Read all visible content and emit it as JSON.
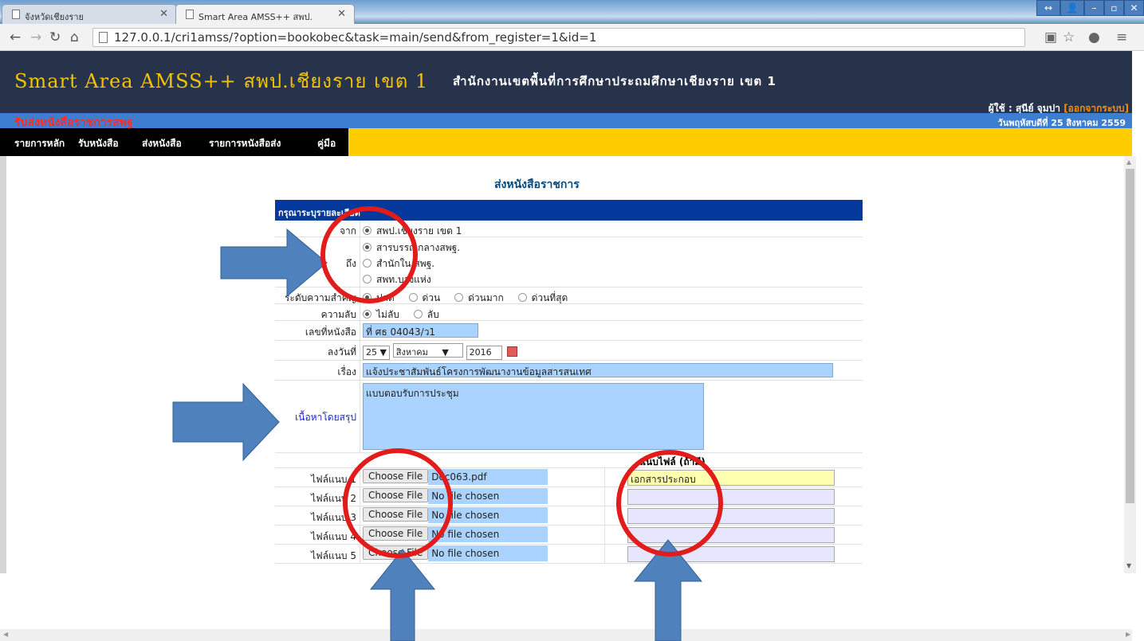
{
  "browser": {
    "tabs": [
      {
        "title": "จังหวัดเชียงราย",
        "active": false
      },
      {
        "title": "Smart Area AMSS++ สพป.",
        "active": true
      }
    ],
    "url": "127.0.0.1/cri1amss/?option=bookobec&task=main/send&from_register=1&id=1"
  },
  "header": {
    "title": "Smart Area AMSS++ สพป.เชียงราย เขต 1",
    "subtitle": "สำนักงานเขตพื้นที่การศึกษาประถมศึกษาเชียงราย เขต 1",
    "user_label": "ผู้ใช้ : สุนีย์ จุมปา",
    "logout": "[ออกจากระบบ]",
    "system_name": "รับส่งหนังสือราชการสพฐ",
    "date": "วันพฤหัสบดีที่ 25 สิงหาคม 2559"
  },
  "menu": [
    "รายการหลัก",
    "รับหนังสือ",
    "ส่งหนังสือ",
    "รายการหนังสือส่ง",
    "คู่มือ"
  ],
  "page": {
    "heading": "ส่งหนังสือราชการ",
    "form_head": "กรุณาระบุรายละเอียด",
    "labels": {
      "from": "จาก",
      "to": "ถึง",
      "priority": "ระดับความสำคัญ",
      "secret": "ความลับ",
      "doc_no": "เลขที่หนังสือ",
      "date": "ลงวันที่",
      "subject": "เรื่อง",
      "summary": "เนื้อหาโดยสรุป",
      "attachments": "แนบไฟล์ (ถ้ามี)"
    },
    "from_value": "สพป.เชียงราย เขต 1",
    "to_options": [
      "สารบรรณกลางสพฐ.",
      "สำนักใน สพฐ.",
      "สพท.บางแห่ง"
    ],
    "priority_options": [
      "ปกติ",
      "ด่วน",
      "ด่วนมาก",
      "ด่วนที่สุด"
    ],
    "secret_options": [
      "ไม่ลับ",
      "ลับ"
    ],
    "doc_no": "ที่ ศธ 04043/ว1",
    "date_day": "25",
    "date_month": "สิงหาคม",
    "date_year": "2016",
    "subject": "แจ้งประชาสัมพันธ์โครงการพัฒนางานข้อมูลสารสนเทศ",
    "summary": "แบบตอบรับการประชุม",
    "choose_file": "Choose File",
    "attachments": [
      {
        "label": "ไฟล์แนบ 1",
        "file": "Doc063.pdf",
        "desc": "เอกสารประกอบ"
      },
      {
        "label": "ไฟล์แนบ 2",
        "file": "No file chosen",
        "desc": ""
      },
      {
        "label": "ไฟล์แนบ 3",
        "file": "No file chosen",
        "desc": ""
      },
      {
        "label": "ไฟล์แนบ 4",
        "file": "No file chosen",
        "desc": ""
      },
      {
        "label": "ไฟล์แนบ 5",
        "file": "No file chosen",
        "desc": ""
      }
    ]
  },
  "annotation_colors": {
    "arrow": "#4f81bd",
    "circle": "#e21b1b"
  }
}
